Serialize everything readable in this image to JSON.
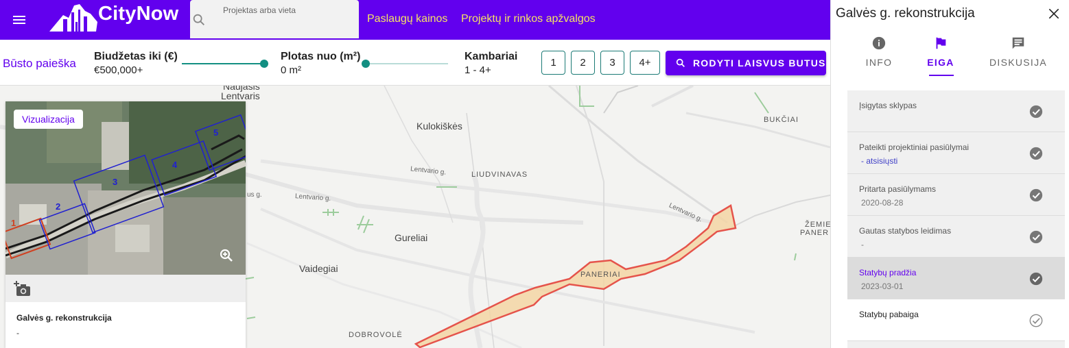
{
  "header": {
    "brand": "CityNow",
    "search_placeholder": "Projektas arba vieta",
    "nav": [
      "Paslaugų kainos",
      "Projektų ir rinkos apžvalgos"
    ]
  },
  "filters": {
    "search_link": "Būsto paieška",
    "budget_label": "Biudžetas iki (€)",
    "budget_value": "€500,000+",
    "area_label": "Plotas nuo (m²)",
    "area_value": "0 m²",
    "rooms_label": "Kambariai",
    "rooms_value": "1 - 4+",
    "room_options": [
      "1",
      "2",
      "3",
      "4+"
    ],
    "show_button": "RODYTI LAISVUS BUTUS",
    "budget_slider_level": 1.0,
    "area_slider_level": 0.0
  },
  "map": {
    "places": {
      "naujasis": "Naujasis",
      "lentvaris": "Lentvaris",
      "kulokiskes": "Kulokiškės",
      "liudvinavas": "LIUDVINAVAS",
      "bukciai": "BUKČIAI",
      "gureliai": "Gureliai",
      "vaidegiai": "Vaidegiai",
      "paneriai": "PANERIAI",
      "dobrovole": "DOBROVOLĖ",
      "zemieji": "ŽEMIE",
      "paneriai2": "PANER"
    },
    "roads": {
      "lentvario1": "Lentvario g.",
      "lentvario2": "Lentvario g.",
      "lentvario3": "Lentvario g.",
      "us_g": "us g."
    }
  },
  "card": {
    "chip": "Vizualizacija",
    "title": "Galvės g. rekonstrukcija",
    "subtitle": "-"
  },
  "panel": {
    "title": "Galvės g. rekonstrukcija",
    "tabs": [
      "INFO",
      "EIGA",
      "DISKUSIJA"
    ],
    "active_tab": "EIGA",
    "steps": [
      {
        "title": "Įsigytas sklypas",
        "sub": ""
      },
      {
        "title": "Pateikti projektiniai pasiūlymai",
        "sub": "- atsisiųsti"
      },
      {
        "title": "Pritarta pasiūlymams",
        "sub": "2020-08-28"
      },
      {
        "title": "Gautas statybos leidimas",
        "sub": "-"
      },
      {
        "title": "Statybų pradžia",
        "sub": "2023-03-01"
      },
      {
        "title": "Statybų pabaiga",
        "sub": ""
      }
    ]
  },
  "colors": {
    "brand": "#6200ee",
    "nav_link": "#f6e363",
    "slider": "#128f82",
    "project_fill": "#f3d5a4",
    "project_stroke": "#e5534b"
  }
}
